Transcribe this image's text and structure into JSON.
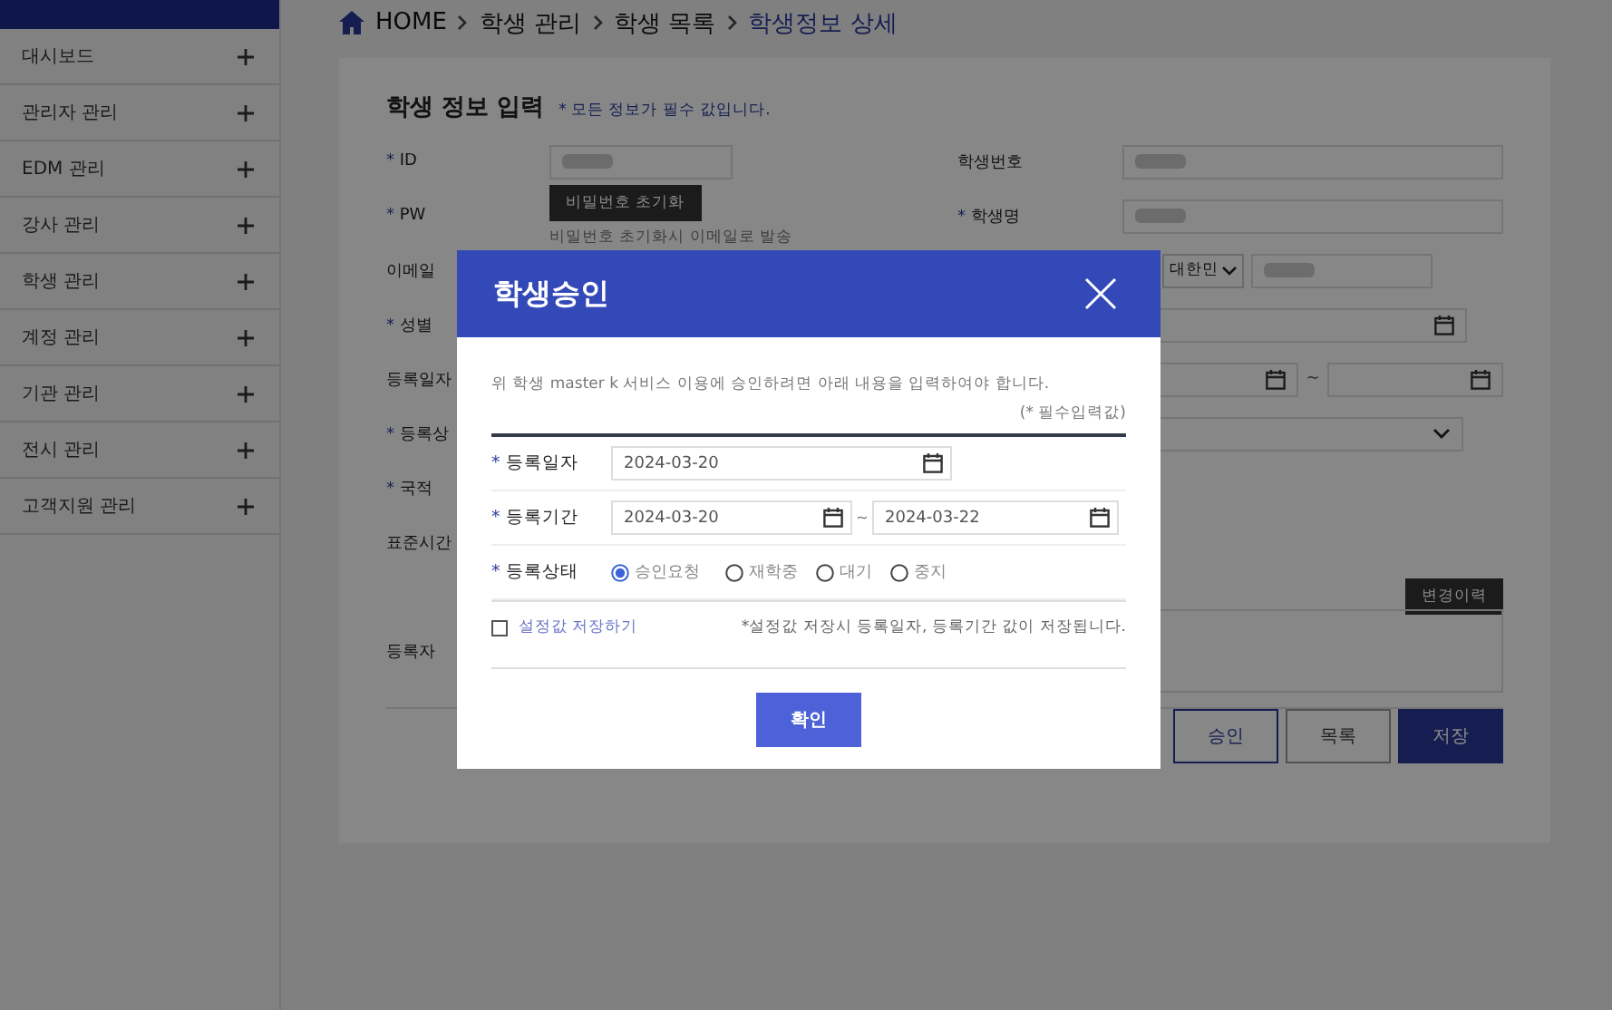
{
  "sidebar": {
    "items": [
      {
        "label": "대시보드"
      },
      {
        "label": "관리자 관리"
      },
      {
        "label": "EDM 관리"
      },
      {
        "label": "강사 관리"
      },
      {
        "label": "학생 관리"
      },
      {
        "label": "계정 관리"
      },
      {
        "label": "기관 관리"
      },
      {
        "label": "전시 관리"
      },
      {
        "label": "고객지원 관리"
      }
    ]
  },
  "breadcrumb": [
    {
      "label": "HOME",
      "current": false
    },
    {
      "label": "학생 관리",
      "current": false
    },
    {
      "label": "학생 목록",
      "current": false
    },
    {
      "label": "학생정보 상세",
      "current": true
    }
  ],
  "form": {
    "title": "학생 정보 입력",
    "note": "* 모든 정보가 필수 값입니다.",
    "id": {
      "mark": "*",
      "label": "ID"
    },
    "student_no": {
      "label": "학생번호"
    },
    "pw": {
      "mark": "*",
      "label": "PW",
      "button": "비밀번호 초기화",
      "hint": "비밀번호 초기화시 이메일로 발송"
    },
    "student_name": {
      "mark": "*",
      "label": "학생명"
    },
    "email": {
      "label": "이메일",
      "country": "대한민"
    },
    "gender": {
      "mark": "*",
      "label": "성별"
    },
    "reg_date": {
      "label": "등록일자",
      "separator": "~"
    },
    "reg_status": {
      "mark": "*",
      "label": "등록상"
    },
    "nationality": {
      "mark": "*",
      "label": "국적"
    },
    "timezone": {
      "label": "표준시간"
    },
    "history_button": "변경이력",
    "registrant": {
      "label": "등록자"
    },
    "buttons": [
      {
        "label": "승인",
        "kind": "outline"
      },
      {
        "label": "목록",
        "kind": "plain"
      },
      {
        "label": "저장",
        "kind": "primary"
      }
    ]
  },
  "modal": {
    "title": "학생승인",
    "intro": "위 학생 master k 서비스 이용에 승인하려면 아래 내용을 입력하여야 합니다.",
    "required_note": "(* 필수입력값)",
    "reg_date": {
      "mark": "*",
      "label": "등록일자",
      "value": "2024-03-20"
    },
    "reg_period": {
      "mark": "*",
      "label": "등록기간",
      "from": "2024-03-20",
      "separator": "~",
      "to": "2024-03-22"
    },
    "reg_status": {
      "mark": "*",
      "label": "등록상태",
      "options": [
        {
          "label": "승인요청",
          "selected": true
        },
        {
          "label": "재학중",
          "selected": false
        },
        {
          "label": "대기",
          "selected": false
        },
        {
          "label": "중지",
          "selected": false
        }
      ]
    },
    "save_settings": {
      "label": "설정값 저장하기",
      "checked": false
    },
    "save_note": "*설정값 저장시 등록일자, 등록기간 값이 저장됩니다.",
    "confirm": "확인"
  }
}
